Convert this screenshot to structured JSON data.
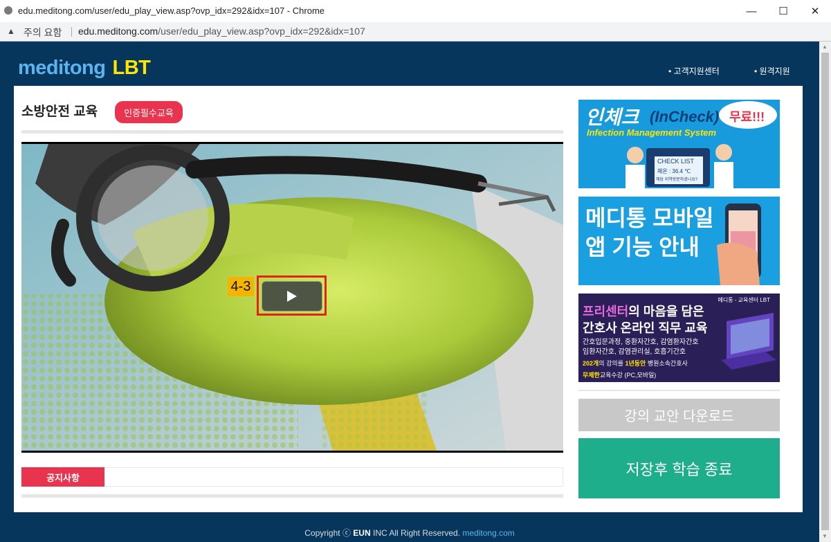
{
  "window": {
    "title": "edu.meditong.com/user/edu_play_view.asp?ovp_idx=292&idx=107 - Chrome",
    "controls": {
      "minimize": "—",
      "maximize": "☐",
      "close": "✕"
    }
  },
  "addressbar": {
    "warning_icon": "warning-icon",
    "warning_text": "주의 요함",
    "domain": "edu.meditong.com",
    "path": "/user/edu_play_view.asp?ovp_idx=292&idx=107"
  },
  "header": {
    "logo_main": "meditong",
    "logo_sub": "LBT",
    "links": [
      "• 고객지원센터",
      "• 원격지원"
    ]
  },
  "course": {
    "title": "소방안전 교육",
    "badge": "인증필수교육"
  },
  "player": {
    "chapter_label": "4-3",
    "play_icon": "play-icon"
  },
  "notice": {
    "label": "공지사항"
  },
  "ads": {
    "incheck": {
      "title": "인체크",
      "title_en": "(InCheck)",
      "bubble": "무료!!!",
      "subtitle": "Infection Management System",
      "card_title": "CHECK LIST",
      "card_line1": "체온 : 36.4 ℃",
      "card_line2": "해당 지역방문하셨나요?"
    },
    "mobile": {
      "line1": "메디통 모바일",
      "line2": "앱 기능 안내"
    },
    "nurse": {
      "tag": "메디통 - 교육센터 LBT",
      "line1a": "프리센터",
      "line1b": "의 마음을 담은",
      "line2": "간호사 온라인 직무 교육",
      "line3": "간호입문과정, 중환자간호, 감염환자간호",
      "line4": "임환자간호, 감염관리실, 호흡기간호",
      "line5a": "202개",
      "line5b": "의 강의를",
      "line5c": "1년동안",
      "line5d": "병원소속간호사",
      "line6a": "무제한",
      "line6b": "교육수강 (PC,모바일)"
    }
  },
  "buttons": {
    "download": "강의 교안 다운로드",
    "save_exit": "저장후 학습 종료"
  },
  "footer": {
    "prefix": "Copyright ⓒ",
    "company": "EUN",
    "rest": "INC All Right Reserved.",
    "site": "meditong.com"
  },
  "colors": {
    "page_bg": "#06365c",
    "accent_red": "#e8344e",
    "logo_yellow": "#ffe600",
    "end_button": "#1eae8c"
  }
}
